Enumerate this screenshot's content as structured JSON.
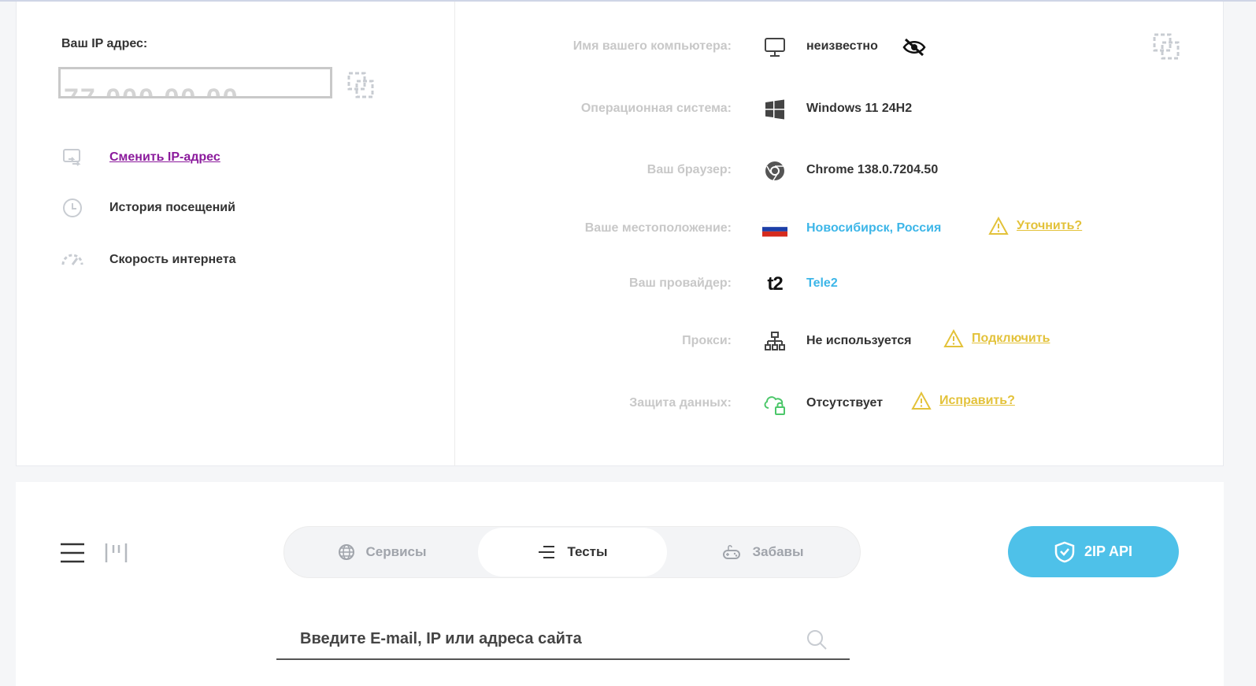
{
  "ip_block": {
    "label": "Ваш IP адрес:",
    "masked_value": "77.000.00.00"
  },
  "menu": [
    {
      "icon": "change-ip-icon",
      "label": "Сменить IP-адрес"
    },
    {
      "icon": "history-icon",
      "label": "История посещений"
    },
    {
      "icon": "speedometer-icon",
      "label": "Скорость интернета"
    }
  ],
  "info": {
    "computer": {
      "label": "Имя вашего компьютера:",
      "value": "неизвестно",
      "icon": "monitor-icon"
    },
    "os": {
      "label": "Операционная система:",
      "value": "Windows 11 24H2",
      "icon": "windows-icon"
    },
    "browser": {
      "label": "Ваш браузер:",
      "value": "Chrome 138.0.7204.50",
      "icon": "chrome-icon"
    },
    "location": {
      "label": "Ваше местоположение:",
      "value": "Новосибирск, Россия",
      "icon": "russia-flag-icon",
      "action": "Уточнить?"
    },
    "provider": {
      "label": "Ваш провайдер:",
      "value": "Tele2",
      "icon": "t2-logo-icon"
    },
    "proxy": {
      "label": "Прокси:",
      "value": "Не используется",
      "icon": "network-icon",
      "action": "Подключить"
    },
    "protection": {
      "label": "Защита данных:",
      "value": "Отсутствует",
      "icon": "cloud-lock-icon",
      "action": "Исправить?"
    }
  },
  "tabs": [
    {
      "label": "Сервисы",
      "icon": "globe-icon",
      "active": false
    },
    {
      "label": "Тесты",
      "icon": "lines-icon",
      "active": true
    },
    {
      "label": "Забавы",
      "icon": "gamepad-icon",
      "active": false
    }
  ],
  "api_button": {
    "label": "2IP API"
  },
  "search": {
    "placeholder": "Введите E-mail, IP или адреса сайта"
  },
  "colors": {
    "accent_blue": "#4ec1e9",
    "link_purple": "#8b1a9c",
    "warn_yellow": "#e3c23a",
    "location_blue": "#3db6e8"
  }
}
